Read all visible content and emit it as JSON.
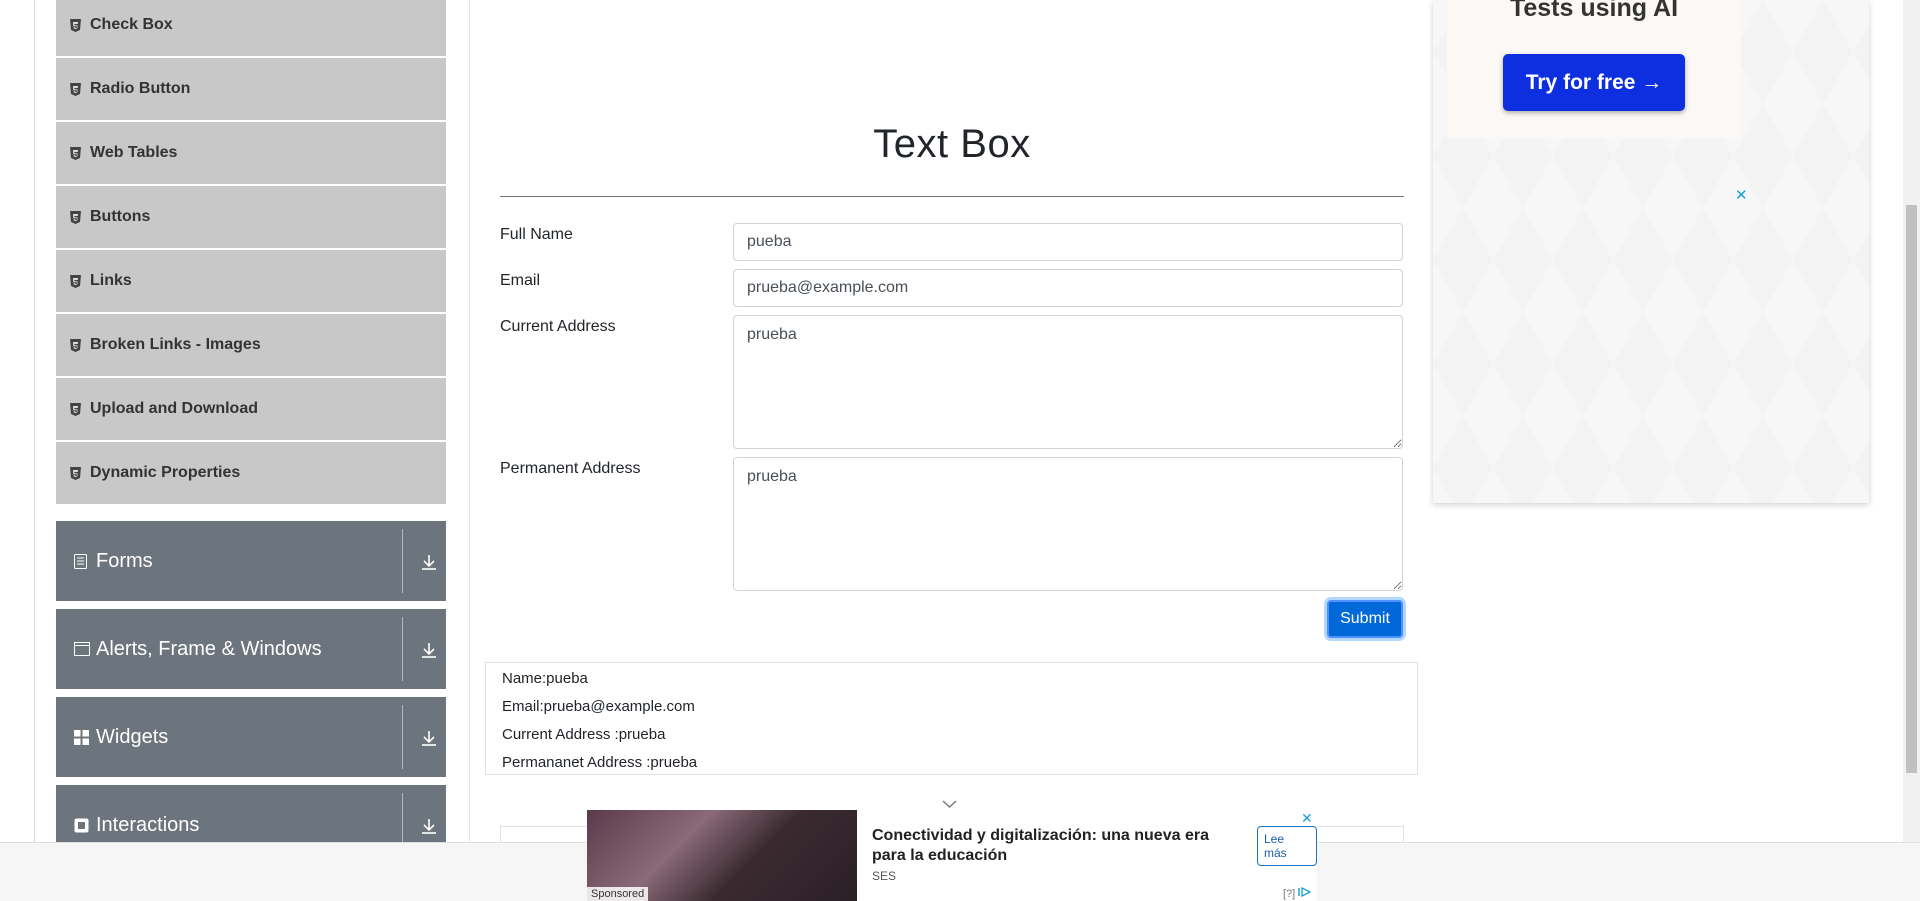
{
  "sidebar": {
    "sub_items": [
      {
        "label": "Check Box"
      },
      {
        "label": "Radio Button"
      },
      {
        "label": "Web Tables"
      },
      {
        "label": "Buttons"
      },
      {
        "label": "Links"
      },
      {
        "label": "Broken Links - Images"
      },
      {
        "label": "Upload and Download"
      },
      {
        "label": "Dynamic Properties"
      }
    ],
    "groups": [
      {
        "label": "Forms",
        "icon": "form-icon"
      },
      {
        "label": "Alerts, Frame & Windows",
        "icon": "window-icon"
      },
      {
        "label": "Widgets",
        "icon": "widgets-icon"
      },
      {
        "label": "Interactions",
        "icon": "interactions-icon"
      }
    ]
  },
  "main": {
    "title": "Text Box",
    "fields": {
      "full_name": {
        "label": "Full Name",
        "value": "pueba"
      },
      "email": {
        "label": "Email",
        "value": "prueba@example.com"
      },
      "current_address": {
        "label": "Current Address",
        "value": "prueba"
      },
      "permanent_address": {
        "label": "Permanent Address",
        "value": "prueba"
      }
    },
    "submit_label": "Submit",
    "output": {
      "name": "Name:pueba",
      "email": "Email:prueba@example.com",
      "current": "Current Address :prueba",
      "permanent": "Permananet Address :prueba"
    }
  },
  "right_ad": {
    "headline": "Tests using AI",
    "cta": "Try for free →",
    "close": "✕"
  },
  "bottom_ad": {
    "sponsored": "Sponsored",
    "title": "Conectividad y digitalización: una nueva era para la educación",
    "source": "SES",
    "button": "Lee más",
    "close": "✕",
    "info": "[?]"
  },
  "colors": {
    "sidebar_item_bg": "#c8c8c8",
    "group_bg": "#6c757d",
    "submit_bg": "#0069d9",
    "ad_cta_bg": "#0d2fe0"
  }
}
